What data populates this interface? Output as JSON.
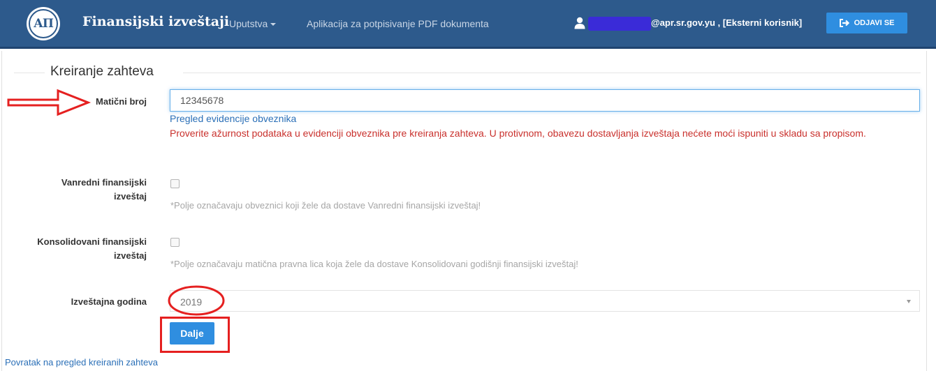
{
  "navbar": {
    "logo_text": "АП",
    "brand": "Finansijski izveštaji",
    "menu_uputstva": "Uputstva",
    "menu_aplikacija": "Aplikacija za potpisivanje PDF dokumenta",
    "user_text": "@apr.sr.gov.yu , [Eksterni korisnik]",
    "logout_label": "ODJAVI SE",
    "bg_color": "#2d5a8c",
    "button_color": "#2f8ee0"
  },
  "form": {
    "title": "Kreiranje zahteva",
    "maticni_broj": {
      "label": "Matični broj",
      "value": "12345678"
    },
    "pregled_link": "Pregled evidencije obveznika",
    "warning": "Proverite ažurnost podataka u evidenciji obveznika pre kreiranja zahteva. U protivnom, obavezu dostavljanja izveštaja nećete moći ispuniti u skladu sa propisom.",
    "vanredni": {
      "label": "Vanredni finansijski izveštaj",
      "checked": false,
      "help": "*Polje označavaju obveznici koji žele da dostave Vanredni finansijski izveštaj!"
    },
    "konsolidovani": {
      "label": "Konsolidovani finansijski izveštaj",
      "checked": false,
      "help": "*Polje označavaju matična pravna lica koja žele da dostave Konsolidovani godišnji finansijski izveštaj!"
    },
    "izvestajna_godina": {
      "label": "Izveštajna godina",
      "selected": "2019"
    },
    "next_button": "Dalje",
    "back_link": "Povratak na pregled kreiranih zahteva"
  },
  "annotation_color": "#e52020"
}
